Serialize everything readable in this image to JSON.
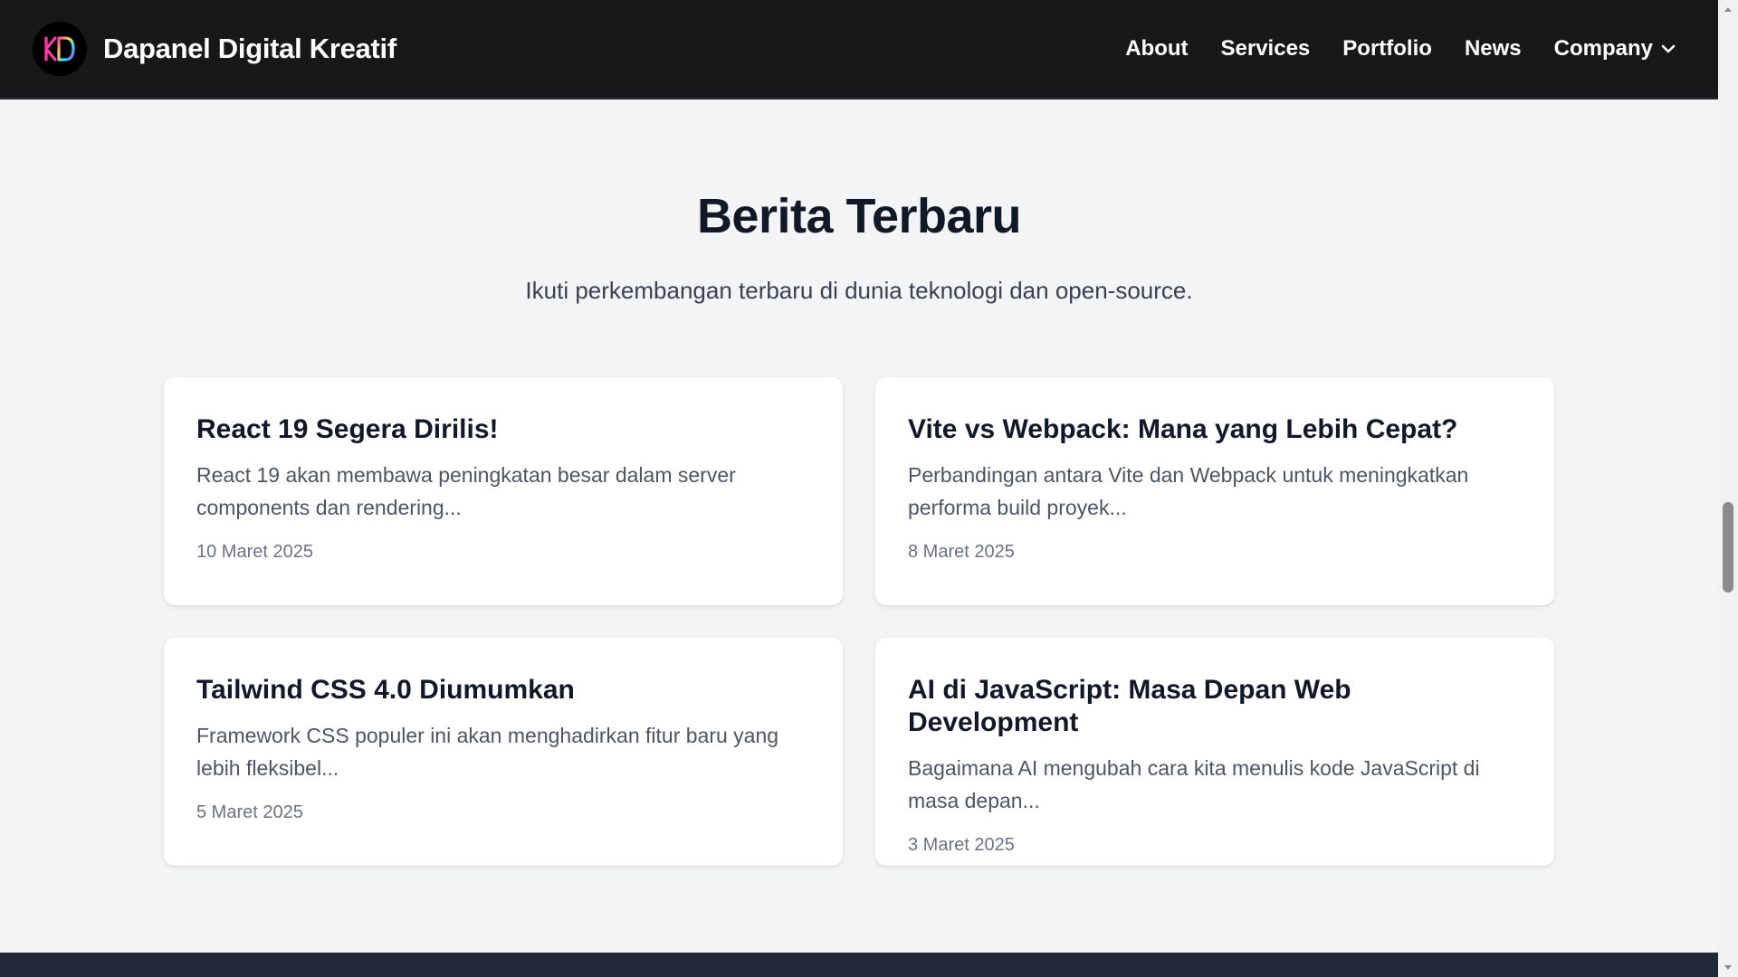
{
  "navbar": {
    "brand_name": "Dapanel Digital Kreatif",
    "logo_text": "KD",
    "links": [
      "About",
      "Services",
      "Portfolio",
      "News"
    ],
    "dropdown_label": "Company"
  },
  "section": {
    "title": "Berita Terbaru",
    "subtitle": "Ikuti perkembangan terbaru di dunia teknologi dan open-source."
  },
  "news": [
    {
      "title": "React 19 Segera Dirilis!",
      "excerpt": "React 19 akan membawa peningkatan besar dalam server components dan rendering...",
      "date": "10 Maret 2025"
    },
    {
      "title": "Vite vs Webpack: Mana yang Lebih Cepat?",
      "excerpt": "Perbandingan antara Vite dan Webpack untuk meningkatkan performa build proyek...",
      "date": "8 Maret 2025"
    },
    {
      "title": "Tailwind CSS 4.0 Diumumkan",
      "excerpt": "Framework CSS populer ini akan menghadirkan fitur baru yang lebih fleksibel...",
      "date": "5 Maret 2025"
    },
    {
      "title": "AI di JavaScript: Masa Depan Web Development",
      "excerpt": "Bagaimana AI mengubah cara kita menulis kode JavaScript di masa depan...",
      "date": "3 Maret 2025"
    }
  ],
  "colors": {
    "navbar_bg": "#18181b",
    "page_bg": "#f3f4f6",
    "card_bg": "#ffffff",
    "footer_bg": "#1f2937",
    "heading": "#111827"
  },
  "icons": {
    "logo": "kd-logo-icon",
    "dropdown": "chevron-down-icon"
  }
}
